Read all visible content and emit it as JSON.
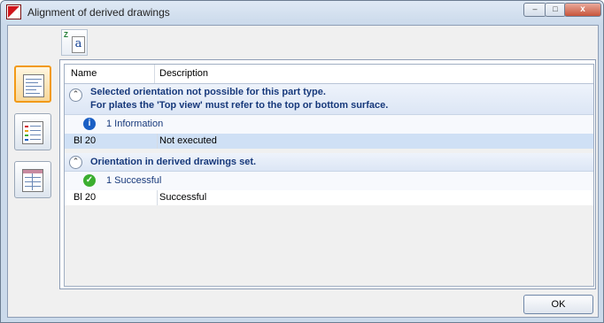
{
  "window": {
    "title": "Alignment of derived drawings"
  },
  "titlebar_buttons": {
    "minimize": "–",
    "maximize": "□",
    "close": "x"
  },
  "toolbar": {
    "icon_z": "Z",
    "icon_a": "a"
  },
  "table": {
    "columns": [
      "Name",
      "Description"
    ],
    "groups": [
      {
        "title_lines": [
          "Selected orientation not possible for this part type.",
          "For plates the 'Top view' must refer to the top or bottom surface."
        ],
        "status_icon": "info-icon",
        "status_glyph": "i",
        "status_text": "1 Information",
        "rows": [
          {
            "name": "Bl 20",
            "description": "Not executed"
          }
        ]
      },
      {
        "title_lines": [
          "Orientation in derived drawings set."
        ],
        "status_icon": "check-icon",
        "status_glyph": "✓",
        "status_text": "1 Successful",
        "rows": [
          {
            "name": "Bl 20",
            "description": "Successful"
          }
        ]
      }
    ]
  },
  "footer": {
    "ok_label": "OK"
  },
  "colors": {
    "accent": "#f29a17",
    "group_text": "#17397b",
    "info": "#1a5fc4",
    "success": "#3bae2f",
    "selected_row": "#cfe0f5"
  }
}
